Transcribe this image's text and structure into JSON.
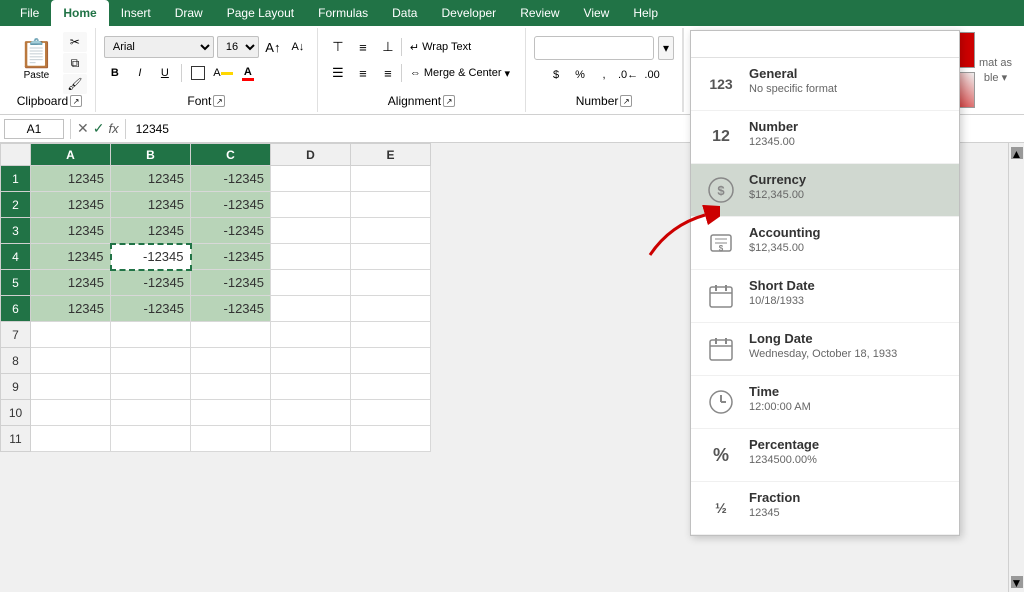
{
  "ribbon": {
    "tabs": [
      "File",
      "Home",
      "Insert",
      "Draw",
      "Page Layout",
      "Formulas",
      "Data",
      "Developer",
      "Review",
      "View",
      "Help"
    ],
    "active_tab": "Home",
    "groups": {
      "clipboard": {
        "label": "Clipboard",
        "paste": "Paste"
      },
      "font": {
        "label": "Font",
        "font_name": "Arial",
        "font_size": "16",
        "bold": "B",
        "italic": "I",
        "underline": "U"
      },
      "alignment": {
        "label": "Alignment",
        "wrap_text": "Wrap Text",
        "merge_center": "Merge & Center"
      },
      "number": {
        "label": "Number"
      }
    }
  },
  "formula_bar": {
    "cell_ref": "A1",
    "formula": "12345"
  },
  "format_dropdown": {
    "search_placeholder": "",
    "items": [
      {
        "id": "general",
        "icon": "123",
        "name": "General",
        "desc": "No specific format"
      },
      {
        "id": "number",
        "icon": "12",
        "name": "Number",
        "desc": "12345.00"
      },
      {
        "id": "currency",
        "icon": "$",
        "name": "Currency",
        "desc": "$12,345.00",
        "selected": true
      },
      {
        "id": "accounting",
        "icon": "$≡",
        "name": "Accounting",
        "desc": "$12,345.00"
      },
      {
        "id": "short_date",
        "icon": "📅",
        "name": "Short Date",
        "desc": "10/18/1933"
      },
      {
        "id": "long_date",
        "icon": "📅",
        "name": "Long Date",
        "desc": "Wednesday, October 18, 1933"
      },
      {
        "id": "time",
        "icon": "🕐",
        "name": "Time",
        "desc": "12:00:00 AM"
      },
      {
        "id": "percentage",
        "icon": "%",
        "name": "Percentage",
        "desc": "1234500.00%"
      },
      {
        "id": "fraction",
        "icon": "½",
        "name": "Fraction",
        "desc": "12345"
      }
    ]
  },
  "spreadsheet": {
    "col_headers": [
      "A",
      "B",
      "C",
      "D",
      "E"
    ],
    "rows": [
      {
        "num": 1,
        "cells": [
          "12345",
          "12345",
          "-12345",
          "",
          ""
        ]
      },
      {
        "num": 2,
        "cells": [
          "12345",
          "12345",
          "-12345",
          "",
          ""
        ]
      },
      {
        "num": 3,
        "cells": [
          "12345",
          "12345",
          "-12345",
          "",
          ""
        ]
      },
      {
        "num": 4,
        "cells": [
          "12345",
          "-12345",
          "-12345",
          "",
          ""
        ]
      },
      {
        "num": 5,
        "cells": [
          "12345",
          "-12345",
          "-12345",
          "",
          ""
        ]
      },
      {
        "num": 6,
        "cells": [
          "12345",
          "-12345",
          "-12345",
          "",
          ""
        ]
      },
      {
        "num": 7,
        "cells": [
          "",
          "",
          "",
          "",
          ""
        ]
      },
      {
        "num": 8,
        "cells": [
          "",
          "",
          "",
          "",
          ""
        ]
      },
      {
        "num": 9,
        "cells": [
          "",
          "",
          "",
          "",
          ""
        ]
      },
      {
        "num": 10,
        "cells": [
          "",
          "",
          "",
          "",
          ""
        ]
      },
      {
        "num": 11,
        "cells": [
          "",
          "",
          "",
          "",
          ""
        ]
      }
    ]
  }
}
